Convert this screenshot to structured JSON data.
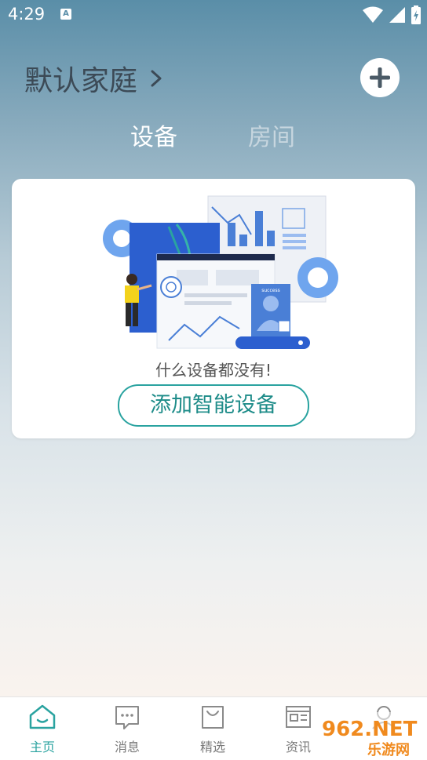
{
  "status_bar": {
    "time": "4:29",
    "notification_icon": "A"
  },
  "header": {
    "home_name": "默认家庭",
    "add_icon": "plus-icon"
  },
  "tabs": [
    {
      "label": "设备",
      "active": true
    },
    {
      "label": "房间",
      "active": false
    }
  ],
  "empty_state": {
    "message": "什么设备都没有!",
    "add_button_label": "添加智能设备",
    "illustration_badge": "success"
  },
  "bottom_nav": {
    "items": [
      {
        "label": "主页",
        "icon": "home-icon",
        "active": true
      },
      {
        "label": "消息",
        "icon": "message-icon",
        "active": false
      },
      {
        "label": "精选",
        "icon": "bag-icon",
        "active": false
      },
      {
        "label": "资讯",
        "icon": "news-icon",
        "active": false
      },
      {
        "label": "",
        "icon": "person-icon",
        "active": false
      }
    ]
  },
  "watermark": {
    "text_top": "962.NET",
    "text_bottom": "乐游网"
  },
  "colors": {
    "accent": "#2aa3a0",
    "title": "#3c4a56"
  }
}
